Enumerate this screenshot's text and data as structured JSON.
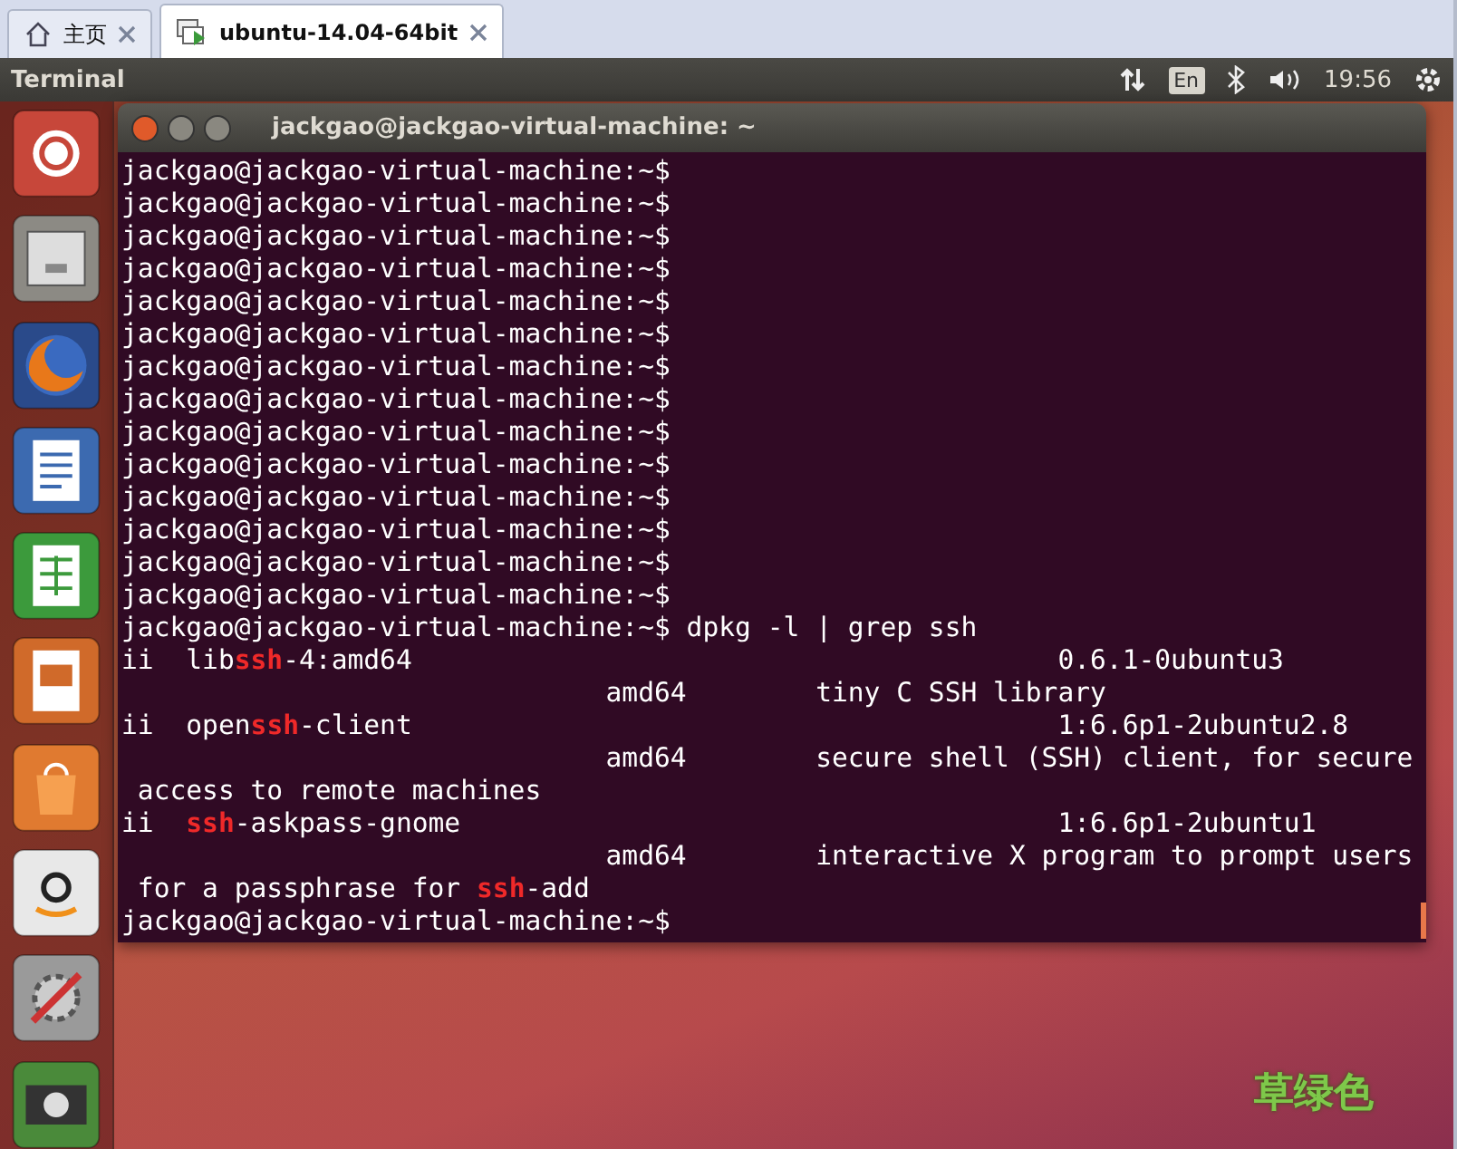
{
  "tabs": [
    {
      "label": "主页",
      "selected": false,
      "kind": "home"
    },
    {
      "label": "ubuntu-14.04-64bit",
      "selected": true,
      "kind": "vm"
    }
  ],
  "top_panel": {
    "app_title": "Terminal",
    "keyboard": "En",
    "time": "19:56"
  },
  "launcher": [
    {
      "kind": "dash"
    },
    {
      "kind": "files"
    },
    {
      "kind": "firefox"
    },
    {
      "kind": "writer"
    },
    {
      "kind": "calc"
    },
    {
      "kind": "impress"
    },
    {
      "kind": "software"
    },
    {
      "kind": "amazon"
    },
    {
      "kind": "settings"
    },
    {
      "kind": "workspaces"
    }
  ],
  "terminal": {
    "title": "jackgao@jackgao-virtual-machine: ~",
    "lines": [
      [
        {
          "text": "jackgao@jackgao-virtual-machine:~$",
          "match": false
        }
      ],
      [
        {
          "text": "jackgao@jackgao-virtual-machine:~$",
          "match": false
        }
      ],
      [
        {
          "text": "jackgao@jackgao-virtual-machine:~$",
          "match": false
        }
      ],
      [
        {
          "text": "jackgao@jackgao-virtual-machine:~$",
          "match": false
        }
      ],
      [
        {
          "text": "jackgao@jackgao-virtual-machine:~$",
          "match": false
        }
      ],
      [
        {
          "text": "jackgao@jackgao-virtual-machine:~$",
          "match": false
        }
      ],
      [
        {
          "text": "jackgao@jackgao-virtual-machine:~$",
          "match": false
        }
      ],
      [
        {
          "text": "jackgao@jackgao-virtual-machine:~$",
          "match": false
        }
      ],
      [
        {
          "text": "jackgao@jackgao-virtual-machine:~$",
          "match": false
        }
      ],
      [
        {
          "text": "jackgao@jackgao-virtual-machine:~$",
          "match": false
        }
      ],
      [
        {
          "text": "jackgao@jackgao-virtual-machine:~$",
          "match": false
        }
      ],
      [
        {
          "text": "jackgao@jackgao-virtual-machine:~$",
          "match": false
        }
      ],
      [
        {
          "text": "jackgao@jackgao-virtual-machine:~$",
          "match": false
        }
      ],
      [
        {
          "text": "jackgao@jackgao-virtual-machine:~$",
          "match": false
        }
      ],
      [
        {
          "text": "jackgao@jackgao-virtual-machine:~$ dpkg -l | grep ssh",
          "match": false
        }
      ],
      [
        {
          "text": "ii  lib",
          "match": false
        },
        {
          "text": "ssh",
          "match": true
        },
        {
          "text": "-4:amd64                                        0.6.1-0ubuntu3",
          "match": false
        }
      ],
      [
        {
          "text": "                              amd64        tiny C SSH library",
          "match": false
        }
      ],
      [
        {
          "text": "ii  open",
          "match": false
        },
        {
          "text": "ssh",
          "match": true
        },
        {
          "text": "-client                                        1:6.6p1-2ubuntu2.8",
          "match": false
        }
      ],
      [
        {
          "text": "                              amd64        secure shell (SSH) client, for secure",
          "match": false
        }
      ],
      [
        {
          "text": " access to remote machines",
          "match": false
        }
      ],
      [
        {
          "text": "ii  ",
          "match": false
        },
        {
          "text": "ssh",
          "match": true
        },
        {
          "text": "-askpass-gnome                                     1:6.6p1-2ubuntu1",
          "match": false
        }
      ],
      [
        {
          "text": "                              amd64        interactive X program to prompt users",
          "match": false
        }
      ],
      [
        {
          "text": " for a passphrase for ",
          "match": false
        },
        {
          "text": "ssh",
          "match": true
        },
        {
          "text": "-add",
          "match": false
        }
      ],
      [
        {
          "text": "jackgao@jackgao-virtual-machine:~$",
          "match": false
        }
      ]
    ]
  },
  "annotation": "草绿色"
}
